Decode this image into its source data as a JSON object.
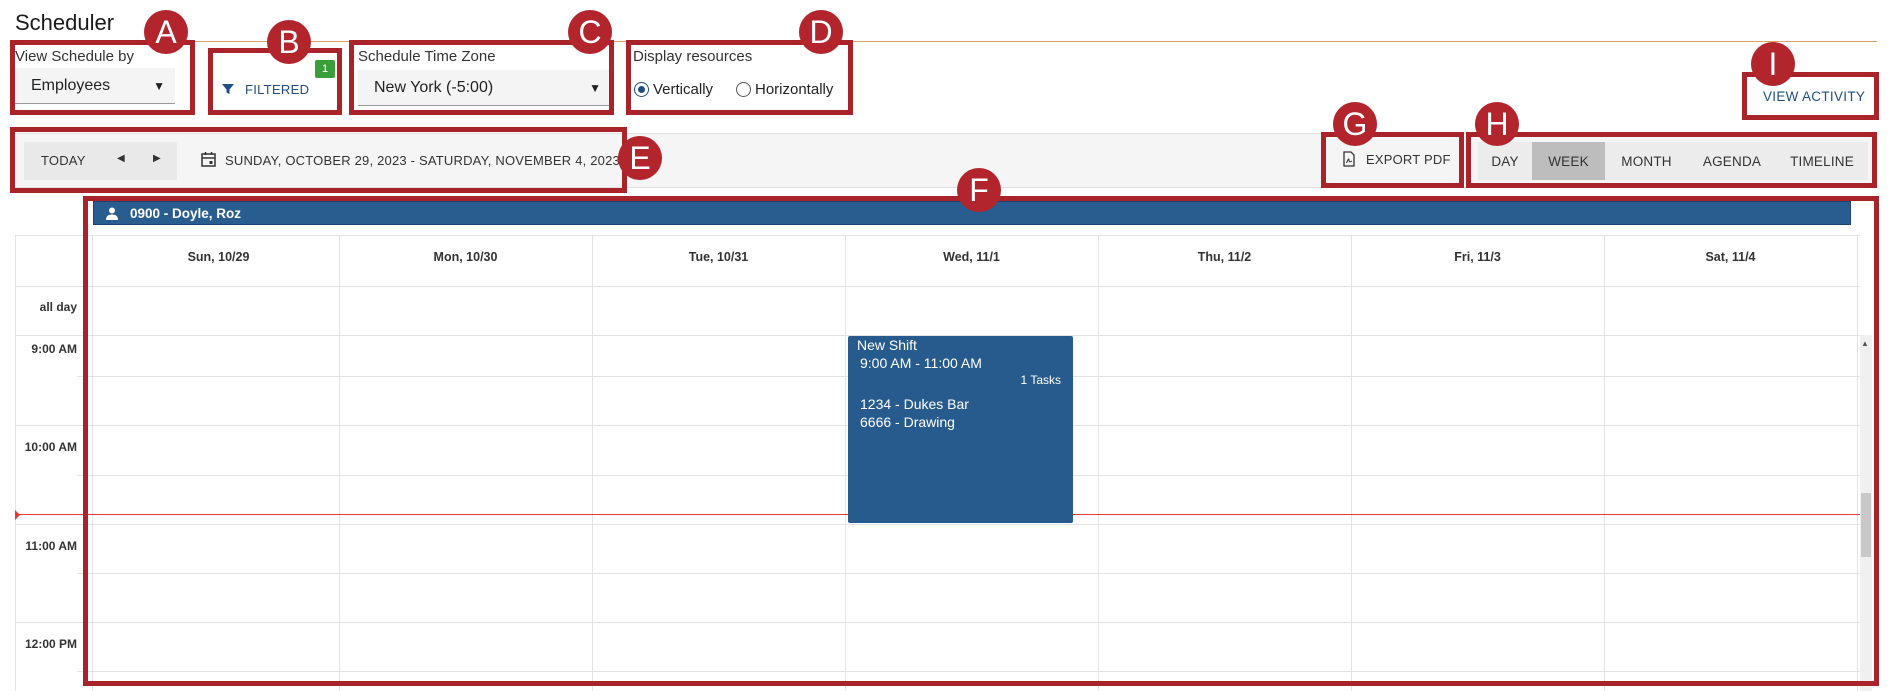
{
  "app": {
    "title": "Scheduler"
  },
  "controls": {
    "view_by_label": "View Schedule by",
    "view_by_value": "Employees",
    "filter_label": "FILTERED",
    "filter_count": "1",
    "timezone_label": "Schedule Time Zone",
    "timezone_value": "New York (-5:00)",
    "display_label": "Display resources",
    "display_vertical": "Vertically",
    "display_horizontal": "Horizontally",
    "display_selected": "Vertically",
    "view_activity": "VIEW ACTIVITY"
  },
  "toolbar": {
    "today": "TODAY",
    "date_range": "SUNDAY, OCTOBER 29, 2023 - SATURDAY, NOVEMBER 4, 2023",
    "export_pdf": "EXPORT PDF",
    "views": [
      "DAY",
      "WEEK",
      "MONTH",
      "AGENDA",
      "TIMELINE"
    ],
    "active_view": "WEEK"
  },
  "resource": {
    "label": "0900 - Doyle, Roz"
  },
  "calendar": {
    "days": [
      "Sun, 10/29",
      "Mon, 10/30",
      "Tue, 10/31",
      "Wed, 11/1",
      "Thu, 11/2",
      "Fri, 11/3",
      "Sat, 11/4"
    ],
    "all_day_label": "all day",
    "times": [
      "9:00 AM",
      "10:00 AM",
      "11:00 AM",
      "12:00 PM"
    ]
  },
  "event": {
    "title": "New Shift",
    "time": "9:00 AM - 11:00 AM",
    "tasks": "1 Tasks",
    "lines": [
      "1234 - Dukes Bar",
      "6666 - Drawing"
    ],
    "color": "#275b8d"
  },
  "annotations": [
    "A",
    "B",
    "C",
    "D",
    "E",
    "F",
    "G",
    "H",
    "I"
  ],
  "colors": {
    "accent": "#1f4e82",
    "annotation": "#b3252c",
    "now_line": "#e53935",
    "badge": "#3a9e3a"
  }
}
